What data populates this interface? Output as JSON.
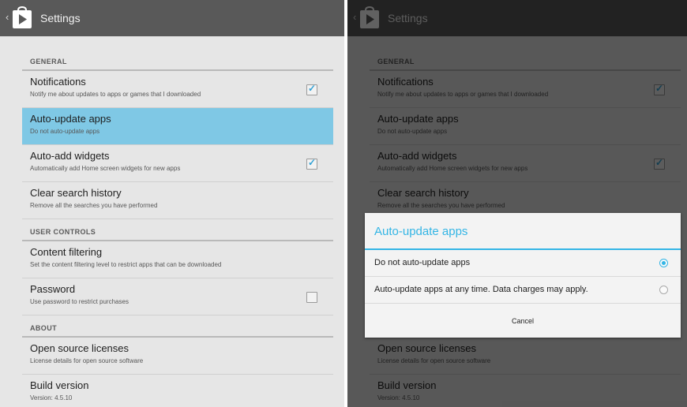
{
  "actionbar": {
    "title": "Settings"
  },
  "sections": {
    "general": "GENERAL",
    "user_controls": "USER CONTROLS",
    "about": "ABOUT"
  },
  "items": {
    "notifications": {
      "title": "Notifications",
      "sub": "Notify me about updates to apps or games that I downloaded",
      "checked": true
    },
    "auto_update": {
      "title": "Auto-update apps",
      "sub": "Do not auto-update apps"
    },
    "auto_widgets": {
      "title": "Auto-add widgets",
      "sub": "Automatically add Home screen widgets for new apps",
      "checked": true
    },
    "clear_search": {
      "title": "Clear search history",
      "sub": "Remove all the searches you have performed"
    },
    "content_filtering": {
      "title": "Content filtering",
      "sub": "Set the content filtering level to restrict apps that can be downloaded"
    },
    "password": {
      "title": "Password",
      "sub": "Use password to restrict purchases",
      "checked": false
    },
    "licenses": {
      "title": "Open source licenses",
      "sub": "License details for open source software"
    },
    "build": {
      "title": "Build version",
      "sub": "Version: 4.5.10"
    }
  },
  "dialog": {
    "title": "Auto-update apps",
    "options": [
      "Do not auto-update apps",
      "Auto-update apps at any time. Data charges may apply."
    ],
    "selected": 0,
    "cancel": "Cancel"
  },
  "colors": {
    "accent": "#33b5e5",
    "selected_row": "#7fc8e5",
    "actionbar": "#595959",
    "background": "#e6e6e6"
  },
  "icons": {
    "back": "chevron-left-icon",
    "app": "play-store-icon",
    "check": "checkmark-icon"
  }
}
